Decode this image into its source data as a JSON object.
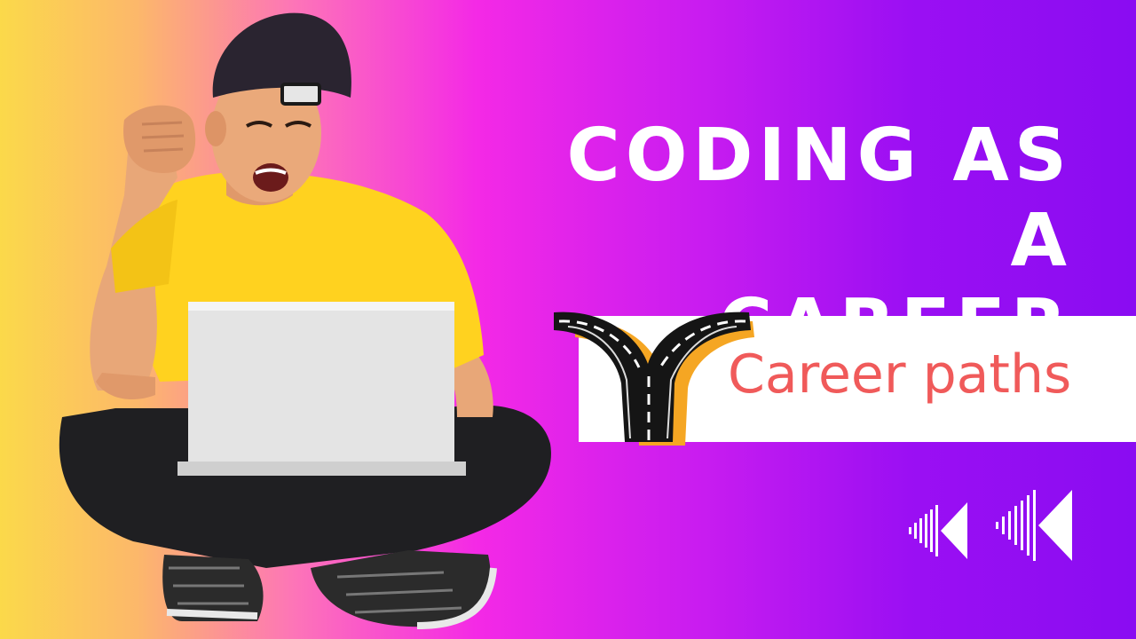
{
  "headline": {
    "line1": "Coding as a",
    "line2": "Career"
  },
  "banner": {
    "label": "Career paths"
  },
  "icons": {
    "road": "forked-road-icon",
    "rewind": "rewind-icon"
  },
  "colors": {
    "banner_text": "#f05a5a",
    "headline": "#ffffff",
    "shirt": "#ffd21f",
    "gradient_left": "#fbd94a",
    "gradient_mid": "#f429e6",
    "gradient_right": "#8a0cf2"
  }
}
